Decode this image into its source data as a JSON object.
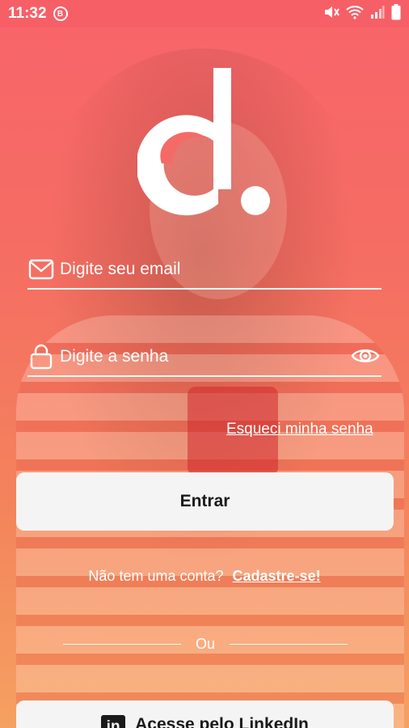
{
  "status_bar": {
    "time": "11:32",
    "badge": "B",
    "icons": [
      "mute-icon",
      "wifi-icon",
      "signal-icon",
      "battery-icon"
    ]
  },
  "login": {
    "email_placeholder": "Digite seu email",
    "password_placeholder": "Digite a senha",
    "forgot_password": "Esqueci minha senha",
    "enter_button": "Entrar",
    "no_account_text": "Não tem uma conta?",
    "signup_link": "Cadastre-se!",
    "divider_text": "Ou",
    "linkedin_button": "Acesse pelo LinkedIn",
    "linkedin_glyph": "in"
  },
  "colors": {
    "gradient_top": "#f8646a",
    "gradient_bottom": "#f5a161",
    "button_bg": "#f5f4f4",
    "button_text": "#1a1a1a"
  }
}
